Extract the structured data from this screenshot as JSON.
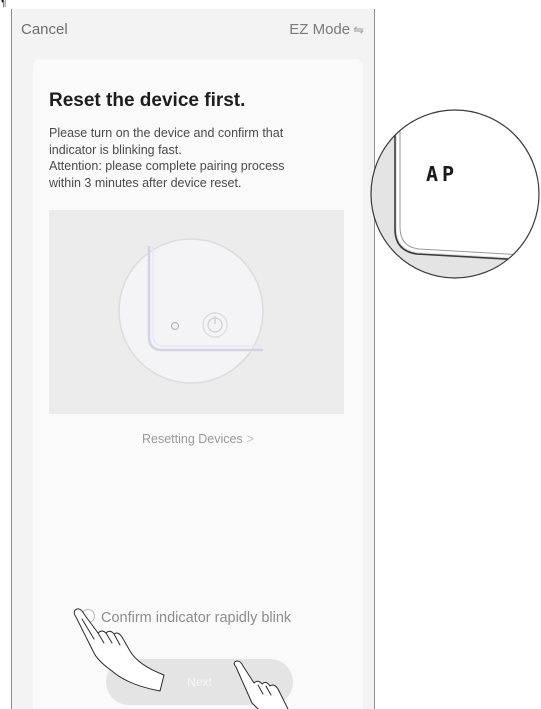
{
  "corner_mark": "¶",
  "header": {
    "cancel_label": "Cancel",
    "mode_label": "EZ Mode",
    "mode_icon": "⇋"
  },
  "card": {
    "title": "Reset the device first.",
    "description_line1": "Please turn on the device and confirm that",
    "description_line2": "indicator is blinking fast.",
    "description_line3": "Attention: please complete pairing process",
    "description_line4": "within 3 minutes after device reset.",
    "help_link": "Resetting Devices",
    "help_chevron": ">"
  },
  "confirm": {
    "label": "Confirm indicator rapidly blink",
    "checked": false
  },
  "next_button": {
    "label": "Next",
    "enabled": false
  },
  "zoom_callout": {
    "display_text": "AP"
  },
  "colors": {
    "screen_bg": "#f3f3f3",
    "card_bg": "#fafafa",
    "button_bg": "#e4e4e4",
    "title_text": "#1e1e1e"
  }
}
